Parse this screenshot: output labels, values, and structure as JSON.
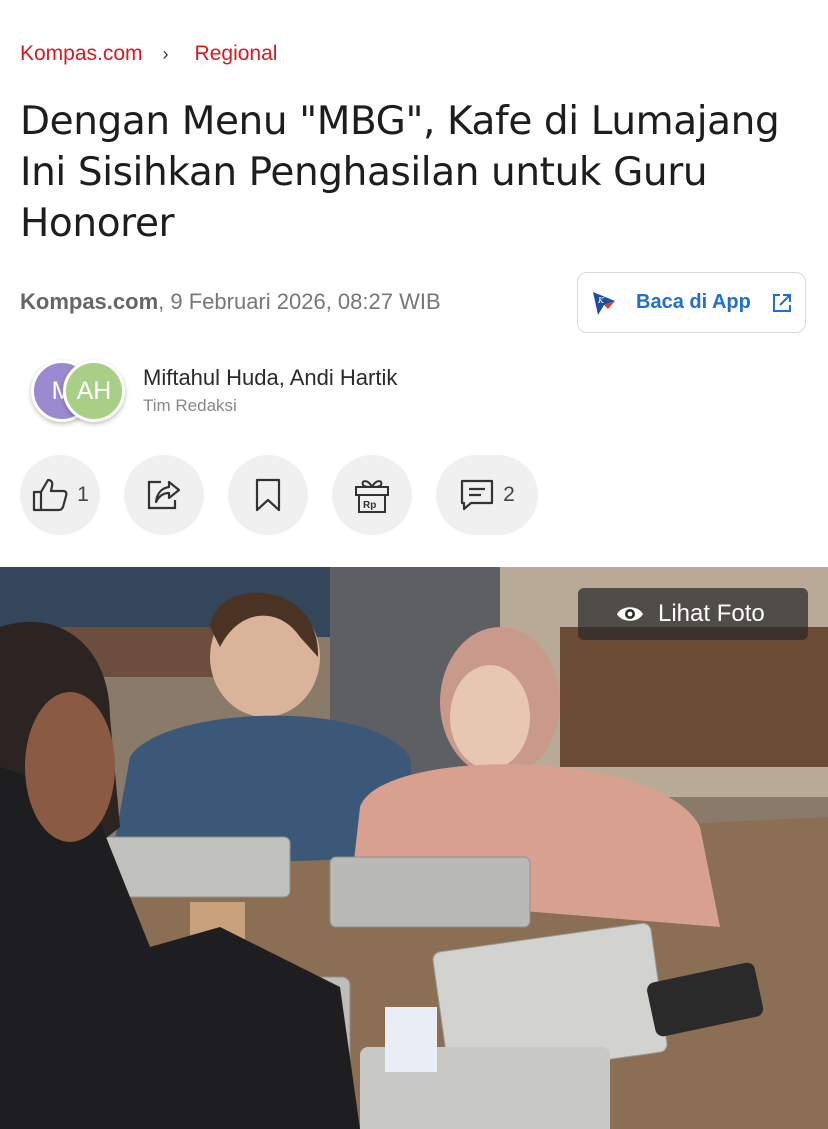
{
  "breadcrumb": {
    "home": "Kompas.com",
    "section": "Regional"
  },
  "article": {
    "title": "Dengan Menu \"MBG\", Kafe di Lumajang Ini Sisihkan Penghasilan untuk Guru Honorer",
    "source": "Kompas.com",
    "date": ", 9 Februari 2026, 08:27 WIB"
  },
  "app_button": {
    "label": "Baca di App"
  },
  "authors": {
    "avatar1": "M",
    "avatar2": "AH",
    "names": "Miftahul Huda,  Andi Hartik",
    "team": "Tim Redaksi"
  },
  "actions": {
    "like_count": "1",
    "comment_count": "2"
  },
  "photo": {
    "view_label": "Lihat Foto"
  },
  "colors": {
    "brand_red": "#d71920",
    "app_blue": "#1f6fd1"
  },
  "icons": [
    "chevron-right-icon",
    "kompas-app-logo",
    "external-link-icon",
    "thumbs-up-icon",
    "share-icon",
    "bookmark-icon",
    "gift-rp-icon",
    "comment-icon",
    "eye-icon"
  ]
}
